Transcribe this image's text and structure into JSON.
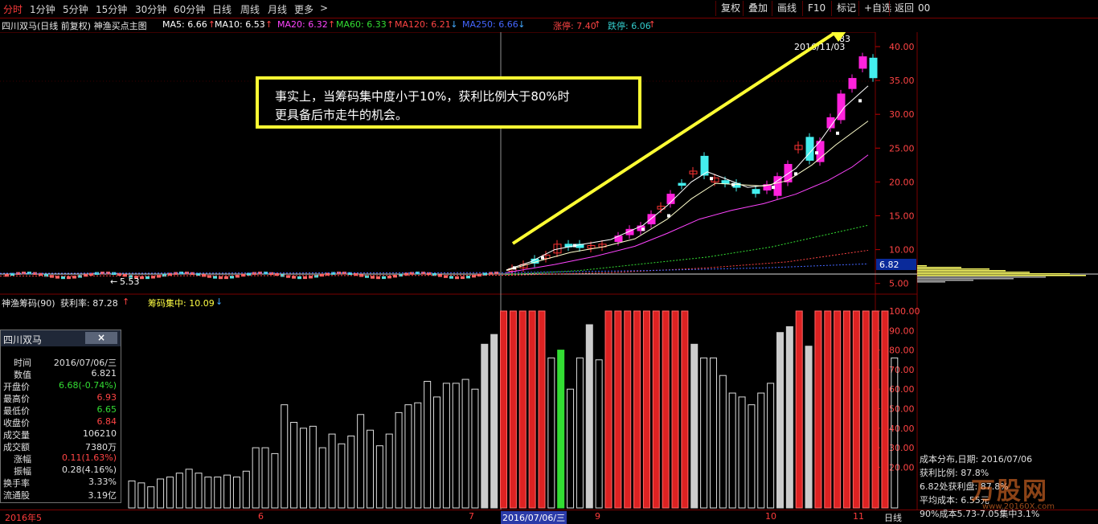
{
  "toolbar": {
    "periods": [
      "分时",
      "1分钟",
      "5分钟",
      "15分钟",
      "30分钟",
      "60分钟",
      "日线",
      "周线",
      "月线",
      "更多"
    ],
    "more_arrow": ">",
    "buttons": [
      "复权",
      "叠加",
      "画线",
      "F10",
      "标记",
      "+自选",
      "返回"
    ],
    "extra": "00"
  },
  "ma_line": {
    "title": "四川双马(日线 前复权) 神渔买点主图",
    "items": [
      {
        "label": "MA5: 6.66",
        "arrow": "↑",
        "color": "#ffffff"
      },
      {
        "label": "MA10: 6.53",
        "arrow": "↑",
        "color": "#ffffff"
      },
      {
        "label": "MA20: 6.32",
        "arrow": "↑",
        "color": "#ff44ff"
      },
      {
        "label": "MA60: 6.33",
        "arrow": "↑",
        "color": "#33dd33"
      },
      {
        "label": "MA120: 6.21",
        "arrow": "↓",
        "color": "#ff4444"
      },
      {
        "label": "MA250: 6.66",
        "arrow": "↓",
        "color": "#4466ff"
      },
      {
        "label": "涨停: 7.40",
        "arrow": "↑",
        "color": "#ff4444"
      },
      {
        "label": "跌停: 6.06",
        "arrow": "↑",
        "color": "#33cccc"
      }
    ]
  },
  "price_axis": [
    "40.00",
    "35.00",
    "30.00",
    "25.00",
    "20.00",
    "15.00",
    "10.00",
    "5.00"
  ],
  "current_price": "6.82",
  "low_marker": "5.53",
  "high_marker": "2016/11/03",
  "high_value": "83",
  "callout": {
    "line1": "事实上，当筹码集中度小于10%，获利比例大于80%时",
    "line2": "更具备后市走牛的机会。"
  },
  "indicator_line": {
    "title": "神渔筹码(90)",
    "profit": "获利率: 87.28",
    "profit_arrow": "↑",
    "conc": "筹码集中: 10.09",
    "conc_arrow": "↓"
  },
  "ind_axis": [
    "100.00",
    "90.00",
    "80.00",
    "70.00",
    "60.00",
    "50.00",
    "40.00",
    "30.00",
    "20.00"
  ],
  "info_panel": {
    "title": "四川双马",
    "close": "×",
    "rows": [
      {
        "label": "时间",
        "value": "2016/07/06/三",
        "color": "#e0e0e0"
      },
      {
        "label": "数值",
        "value": "6.821",
        "color": "#e0e0e0"
      },
      {
        "label": "开盘价",
        "value": "6.68(-0.74%)",
        "color": "#33dd33"
      },
      {
        "label": "最高价",
        "value": "6.93",
        "color": "#ff4444"
      },
      {
        "label": "最低价",
        "value": "6.65",
        "color": "#33dd33"
      },
      {
        "label": "收盘价",
        "value": "6.84",
        "color": "#ff4444"
      },
      {
        "label": "成交量",
        "value": "106210",
        "color": "#e0e0e0"
      },
      {
        "label": "成交额",
        "value": "7380万",
        "color": "#e0e0e0"
      },
      {
        "label": "涨幅",
        "value": "0.11(1.63%)",
        "color": "#ff4444"
      },
      {
        "label": "振幅",
        "value": "0.28(4.16%)",
        "color": "#e0e0e0"
      },
      {
        "label": "换手率",
        "value": "3.33%",
        "color": "#e0e0e0"
      },
      {
        "label": "流通股",
        "value": "3.19亿",
        "color": "#e0e0e0"
      }
    ]
  },
  "bottom_axis": {
    "labels": [
      "2016年5",
      "6",
      "7",
      "2016/07/06/三",
      "9",
      "10",
      "11"
    ],
    "period": "日线"
  },
  "right_info": {
    "title": "成本分布,日期: 2016/07/06",
    "profit_ratio": "获利比例: 87.8%",
    "profit_disk": "6.82处获利盘: 87.8%",
    "avg_cost": "平均成本: 6.55元",
    "cost90": "90%成本5.73-7.05集中3.1%"
  },
  "watermark": "万股网",
  "watermark_url": "www.20160X.com",
  "colors": {
    "up": "#ff2b2b",
    "down": "#33dd33",
    "neutral": "#dddddd",
    "magenta": "#ff22dd",
    "cyan": "#44eeee",
    "yellow": "#ffff33"
  },
  "chart_data": {
    "type": "bar",
    "title": "神渔筹码(90)",
    "ylim": [
      10,
      104
    ],
    "categories": [
      "2016年5",
      "6",
      "7",
      "2016/07/06/三",
      "9",
      "10",
      "11"
    ],
    "series": [
      {
        "name": "获利率",
        "values": [
          13,
          12,
          10,
          14,
          15,
          17,
          19,
          17,
          15,
          15,
          16,
          15,
          18,
          30,
          30,
          27,
          52,
          43,
          40,
          41,
          30,
          37,
          32,
          36,
          47,
          39,
          31,
          37,
          48,
          52,
          53,
          64,
          56,
          63,
          63,
          65,
          60,
          83,
          88,
          100,
          100,
          100,
          100,
          100,
          76,
          80,
          60,
          76,
          93,
          75,
          100,
          100,
          100,
          100,
          100,
          100,
          100,
          100,
          100,
          83,
          76,
          76,
          67,
          58,
          56,
          52,
          58,
          63,
          89,
          92,
          100,
          82,
          100,
          100,
          100,
          100,
          100,
          100,
          100,
          100,
          76
        ]
      }
    ]
  }
}
